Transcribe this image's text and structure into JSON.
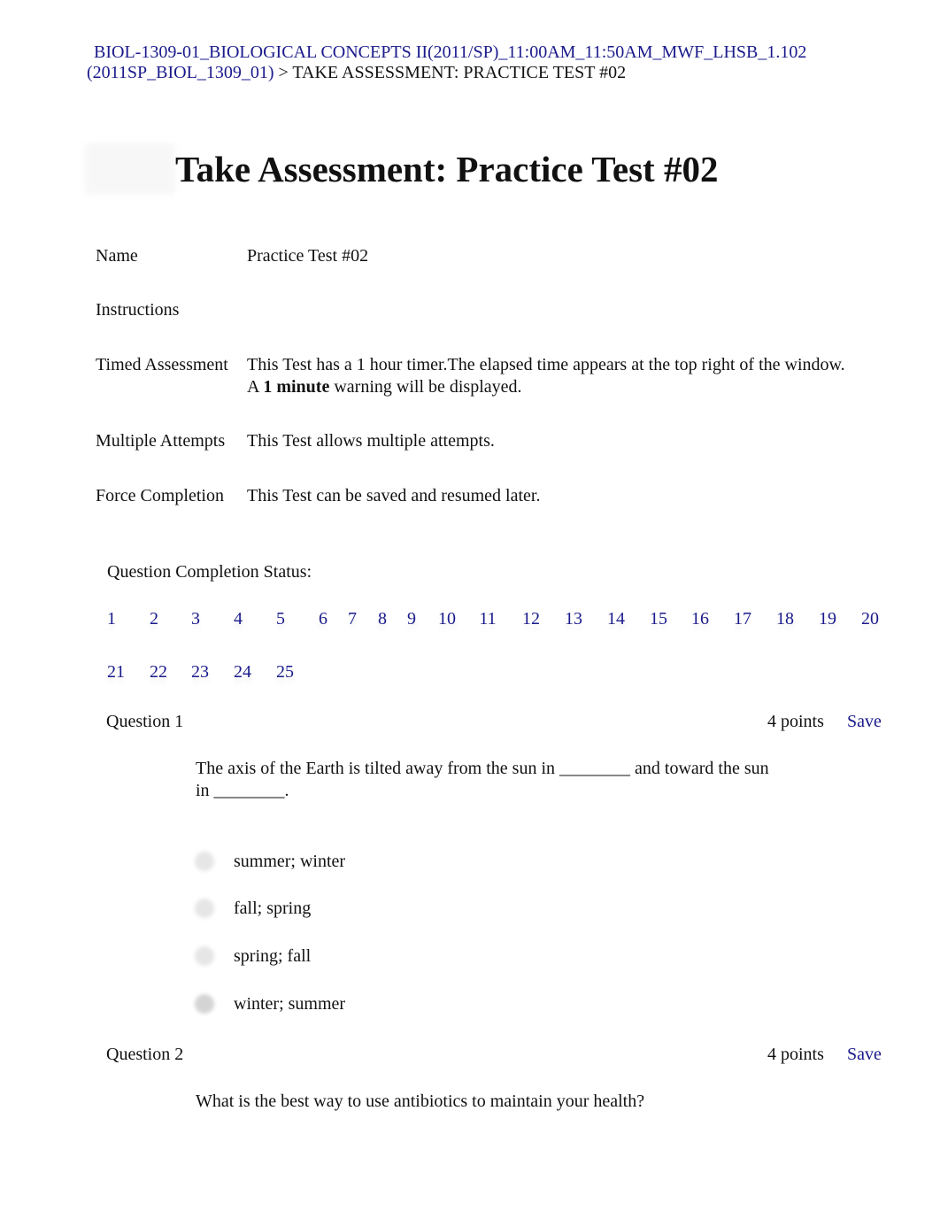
{
  "breadcrumb": {
    "course_link": "BIOL-1309-01_BIOLOGICAL CONCEPTS II(2011/SP)_11:00AM_11:50AM_MWF_LHSB_1.102 (2011SP_BIOL_1309_01)",
    "separator": ">",
    "current": "TAKE ASSESSMENT: PRACTICE TEST #02"
  },
  "page_title": "Take Assessment: Practice Test #02",
  "info": [
    {
      "label": "Name",
      "value": "Practice Test #02"
    },
    {
      "label": "Instructions",
      "value": ""
    },
    {
      "label": "Timed Assessment",
      "value": "This Test has a 1 hour timer.The elapsed time appears at the top right of the window.",
      "value2_pre": "A ",
      "value2_bold": "1 minute",
      "value2_post": " warning will be displayed."
    },
    {
      "label": "Multiple Attempts",
      "value": "This Test allows multiple attempts."
    },
    {
      "label": "Force Completion",
      "value": "This Test can be saved and resumed later."
    }
  ],
  "completion_status": {
    "label": "Question Completion Status:",
    "questions": [
      "1",
      "2",
      "3",
      "4",
      "5",
      "6",
      "7",
      "8",
      "9",
      "10",
      "11",
      "12",
      "13",
      "14",
      "15",
      "16",
      "17",
      "18",
      "19",
      "20",
      "21",
      "22",
      "23",
      "24",
      "25"
    ]
  },
  "questions": [
    {
      "title": "Question 1",
      "points": "4 points",
      "save_label": "Save",
      "text_line1": "The axis of the Earth is tilted away from the sun in ________ and toward the sun",
      "text_line2": "in ________.",
      "options": [
        "summer; winter",
        "fall; spring",
        "spring; fall",
        "winter; summer"
      ]
    },
    {
      "title": "Question 2",
      "points": "4 points",
      "save_label": "Save",
      "text_line1": "What is the best way to use antibiotics to maintain your health?"
    }
  ],
  "colors": {
    "link": "#1a1a8c",
    "text": "#111111"
  }
}
